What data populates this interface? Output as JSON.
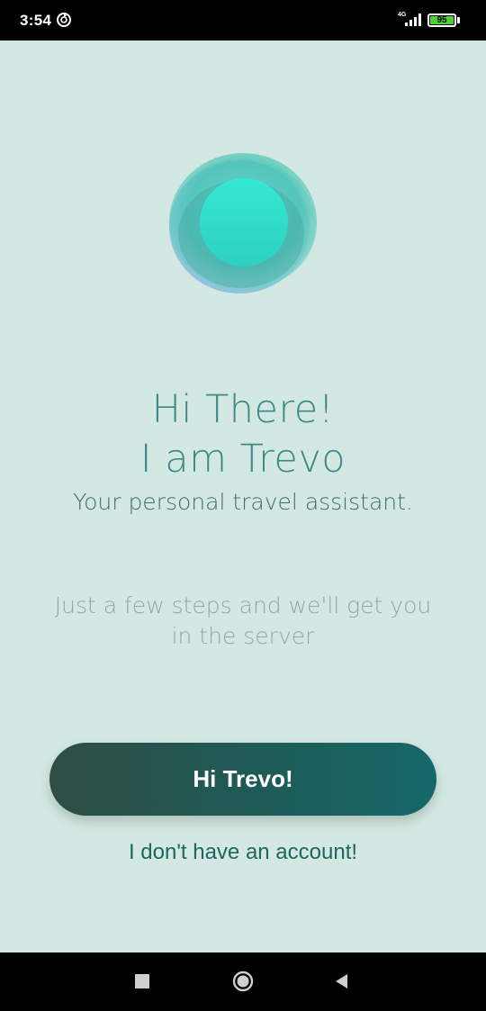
{
  "status_bar": {
    "time": "3:54",
    "network_type": "4G",
    "battery_level": "95",
    "icons": [
      "sync-icon",
      "signal-icon",
      "battery-icon"
    ]
  },
  "hero": {
    "orb_icon": "trevo-orb-logo",
    "colors": {
      "orb_core": "#33e3cf",
      "orb_outer": "#44c4b7",
      "orb_shadow": "#4aa0d8"
    }
  },
  "greeting": {
    "line1": "Hi There!",
    "line2": "I am Trevo",
    "subtitle": "Your personal travel assistant."
  },
  "info": {
    "steps_text": "Just a few steps and we'll get you in the server"
  },
  "actions": {
    "primary_label": "Hi Trevo!",
    "secondary_label": "I don't have an account!"
  },
  "nav_bar": {
    "icons": [
      "recents-icon",
      "home-icon",
      "back-icon"
    ]
  },
  "colors": {
    "background": "#d3e8e2",
    "accent_text": "#3b8a86",
    "button_start": "#2e4d44",
    "button_end": "#15686a",
    "link": "#1d6661"
  }
}
